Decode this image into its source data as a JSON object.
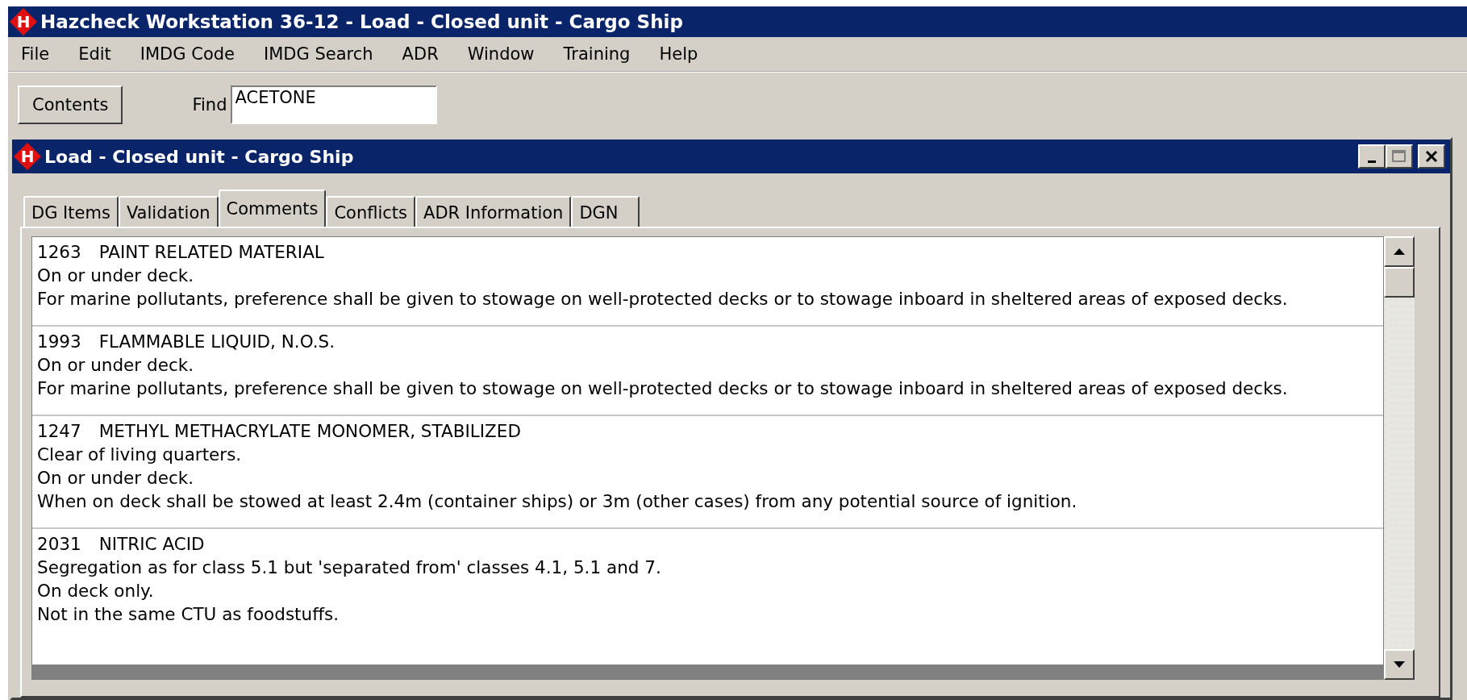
{
  "window": {
    "logo": "H",
    "title": "Hazcheck Workstation 36-12 - Load - Closed unit - Cargo Ship"
  },
  "menu": [
    "File",
    "Edit",
    "IMDG Code",
    "IMDG Search",
    "ADR",
    "Window",
    "Training",
    "Help"
  ],
  "toolbar": {
    "contents_button": "Contents",
    "find_label": "Find",
    "find_value": "ACETONE"
  },
  "inner_window": {
    "logo": "H",
    "title": "Load - Closed unit - Cargo Ship",
    "tabs": [
      {
        "label": "DG Items",
        "selected": false
      },
      {
        "label": "Validation",
        "selected": false
      },
      {
        "label": "Comments",
        "selected": true
      },
      {
        "label": "Conflicts",
        "selected": false
      },
      {
        "label": "ADR Information",
        "selected": false
      },
      {
        "label": "DGN",
        "selected": false
      }
    ],
    "comments": [
      {
        "un_number": "1263",
        "name": "PAINT RELATED MATERIAL",
        "lines": [
          "On or under deck.",
          "For marine pollutants, preference shall be given to stowage on well-protected decks or to stowage inboard in sheltered areas of exposed decks."
        ]
      },
      {
        "un_number": "1993",
        "name": "FLAMMABLE LIQUID, N.O.S.",
        "lines": [
          "On or under deck.",
          "For marine pollutants, preference shall be given to stowage on well-protected decks or to stowage inboard in sheltered areas of exposed decks."
        ]
      },
      {
        "un_number": "1247",
        "name": "METHYL METHACRYLATE MONOMER, STABILIZED",
        "lines": [
          "Clear of living quarters.",
          "On or under deck.",
          "When on deck shall be stowed at least 2.4m (container ships) or 3m (other cases) from any potential source of ignition."
        ]
      },
      {
        "un_number": "2031",
        "name": "NITRIC ACID",
        "lines": [
          "Segregation as for class 5.1 but 'separated from' classes 4.1, 5.1 and 7.",
          "On deck only.",
          "Not in the same CTU as foodstuffs."
        ]
      }
    ]
  }
}
